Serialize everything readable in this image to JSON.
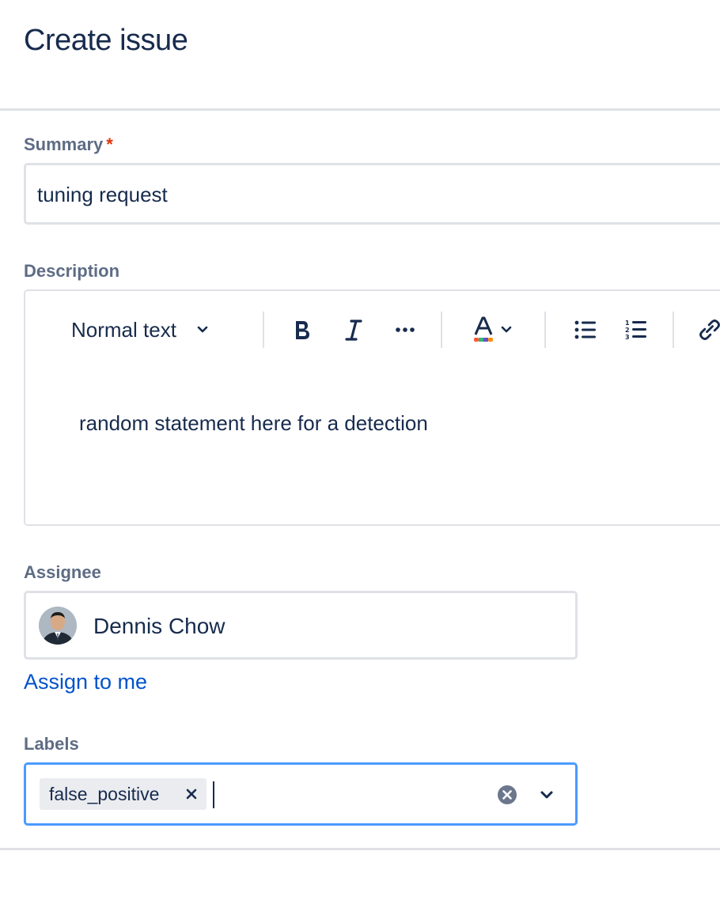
{
  "dialog": {
    "title": "Create issue"
  },
  "summary": {
    "label": "Summary",
    "required_mark": "*",
    "value": "tuning request"
  },
  "description": {
    "label": "Description",
    "toolbar": {
      "text_style": "Normal text"
    },
    "body": "random statement here for a detection"
  },
  "assignee": {
    "label": "Assignee",
    "name": "Dennis Chow",
    "assign_to_me": "Assign to me"
  },
  "labels": {
    "label": "Labels",
    "chips": [
      "false_positive"
    ]
  },
  "colors": {
    "text": "#172b4d",
    "label": "#5e6c84",
    "link": "#0052cc",
    "focus": "#4c9aff",
    "required": "#de350b"
  }
}
